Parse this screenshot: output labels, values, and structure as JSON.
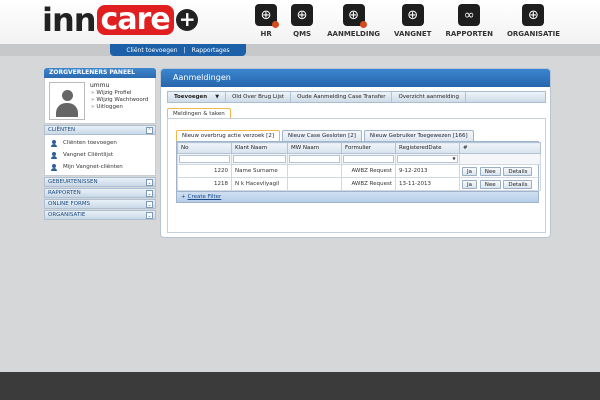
{
  "logo": {
    "part1": "inn",
    "part2": "care",
    "part3": "+"
  },
  "topnav": [
    {
      "label": "HR",
      "icon": "globe-icon",
      "badge": true
    },
    {
      "label": "QMS",
      "icon": "globe-icon",
      "badge": false
    },
    {
      "label": "AANMELDING",
      "icon": "globe-icon",
      "badge": true
    },
    {
      "label": "VANGNET",
      "icon": "globe-icon",
      "badge": false
    },
    {
      "label": "RAPPORTEN",
      "icon": "chain-icon",
      "badge": false
    },
    {
      "label": "ORGANISATIE",
      "icon": "globe-icon",
      "badge": false
    }
  ],
  "subnav": {
    "link1": "Cliënt toevoegen",
    "sep": "|",
    "link2": "Rapportages"
  },
  "sidebar": {
    "title": "ZORGVERLENERS PANEEL",
    "username": "ummu",
    "links": [
      "Wijzig Profiel",
      "Wijzig Wachtwoord",
      "Uitloggen"
    ],
    "sections": [
      {
        "label": "CLIËNTEN",
        "toggle": "⌃",
        "items": [
          "Cliënten toevoegen",
          "Vangnet Cliëntlijst",
          "Mijn Vangnet-cliënten"
        ]
      },
      {
        "label": "GEBEURTENISSEN",
        "toggle": "⌄"
      },
      {
        "label": "RAPPORTEN",
        "toggle": "⌄"
      },
      {
        "label": "ONLINE FORMS",
        "toggle": "⌄"
      },
      {
        "label": "ORGANISATIE",
        "toggle": "⌄"
      }
    ]
  },
  "main": {
    "title": "Aanmeldingen",
    "toolbar": [
      "Toevoegen",
      "Old Over Brug Lijst",
      "Oude Aanmelding Case Transfer",
      "Overzicht aanmelding"
    ],
    "toolbar_caret": "▼",
    "outer_tab": "Meldingen & taken",
    "tabs": [
      "Nieuw overbrug actie verzoek [2]",
      "Nieuw Case Gesloten [2]",
      "Nieuw Gebruiker Toegewezen [166]"
    ],
    "columns": [
      "No",
      "Klant Naam",
      "MW Naam",
      "Formulier",
      "RegisteredDate",
      "#"
    ],
    "filter_dropdown": "▼",
    "rows": [
      {
        "no": "1220",
        "klant": "Name Surname",
        "mw": "",
        "formulier": "AWBZ Request",
        "date": "9-12-2013"
      },
      {
        "no": "1218",
        "klant": "N k Hacevliyagil",
        "mw": "",
        "formulier": "AWBZ Request",
        "date": "13-11-2013"
      }
    ],
    "actions": [
      "Ja",
      "Nee",
      "Details"
    ],
    "footer_plus": "+",
    "footer_link": "Create Filter"
  }
}
